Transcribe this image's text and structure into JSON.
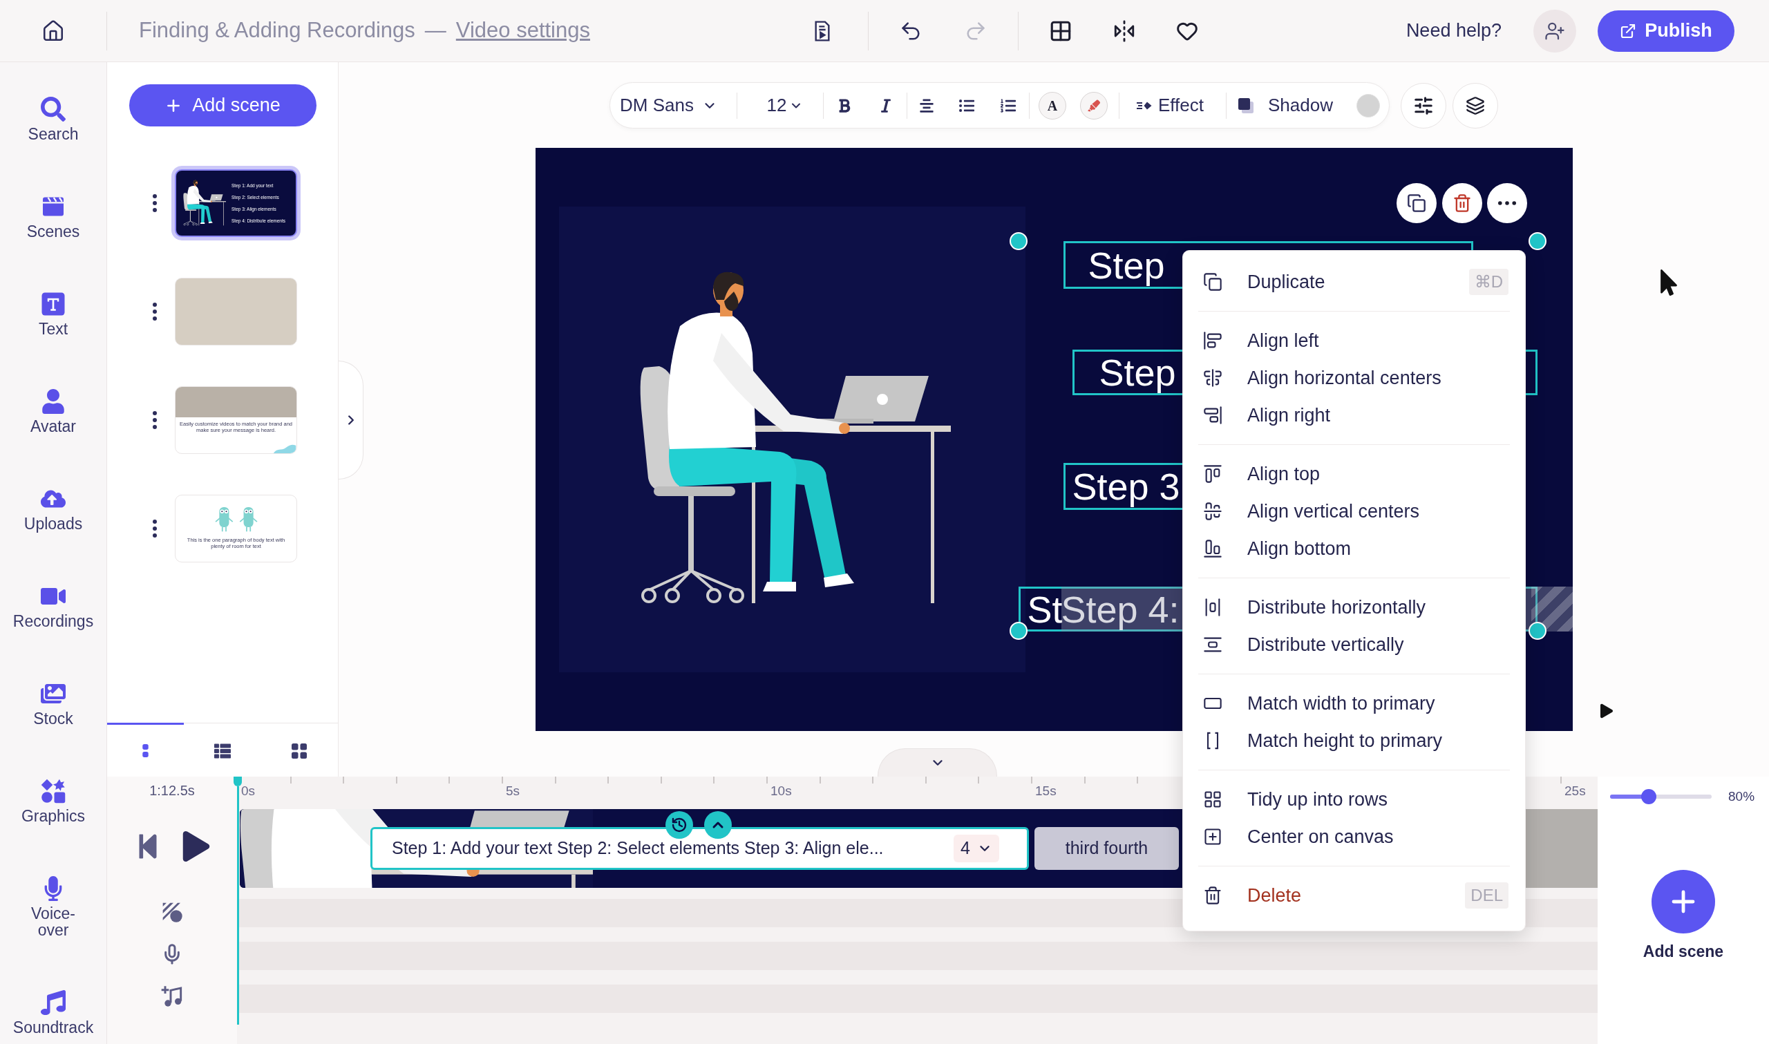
{
  "header": {
    "title": "Finding & Adding Recordings",
    "separator": "—",
    "settings_link": "Video settings",
    "help": "Need help?",
    "publish": "Publish"
  },
  "rail": [
    {
      "label": "Search"
    },
    {
      "label": "Scenes"
    },
    {
      "label": "Text"
    },
    {
      "label": "Avatar"
    },
    {
      "label": "Uploads"
    },
    {
      "label": "Recordings"
    },
    {
      "label": "Stock"
    },
    {
      "label": "Graphics"
    },
    {
      "label": "Voice-over"
    },
    {
      "label": "Soundtrack"
    }
  ],
  "scenes_panel": {
    "add_button": "Add scene",
    "scenes": [
      {
        "kind": "steps",
        "selected": true,
        "texts": [
          "Step 1: Add your text",
          "Step 2: Select elements",
          "Step 3: Align elements",
          "Step 4: Distribute elements"
        ]
      },
      {
        "kind": "photo",
        "selected": false
      },
      {
        "kind": "photo_caption",
        "selected": false,
        "caption": "Easily customize videos to match your brand and make sure your message is heard."
      },
      {
        "kind": "characters",
        "selected": false,
        "caption": "This is the one paragraph of body text with plenty of room for text"
      }
    ],
    "view_tabs": [
      {
        "selected": true
      },
      {
        "selected": false
      },
      {
        "selected": false
      }
    ]
  },
  "toolbar": {
    "font": "DM Sans",
    "size": "12",
    "color_glyph": "A",
    "effect": "Effect",
    "shadow": "Shadow"
  },
  "canvas": {
    "frames": [
      {
        "text": "Step"
      },
      {
        "text": "Step"
      },
      {
        "text": "Step 3"
      },
      {
        "text": "St"
      }
    ],
    "drag_preview": {
      "text": "Step 4:"
    }
  },
  "context_menu": {
    "groups": [
      [
        {
          "label": "Duplicate",
          "shortcut": "⌘D",
          "kind": "normal"
        }
      ],
      [
        {
          "label": "Align left",
          "kind": "normal"
        },
        {
          "label": "Align horizontal centers",
          "kind": "normal"
        },
        {
          "label": "Align right",
          "kind": "normal"
        }
      ],
      [
        {
          "label": "Align top",
          "kind": "normal"
        },
        {
          "label": "Align vertical centers",
          "kind": "normal"
        },
        {
          "label": "Align bottom",
          "kind": "normal"
        }
      ],
      [
        {
          "label": "Distribute horizontally",
          "kind": "normal"
        },
        {
          "label": "Distribute vertically",
          "kind": "normal"
        }
      ],
      [
        {
          "label": "Match width to primary",
          "kind": "normal"
        },
        {
          "label": "Match height to primary",
          "kind": "normal"
        }
      ],
      [
        {
          "label": "Tidy up into rows",
          "kind": "normal"
        },
        {
          "label": "Center on canvas",
          "kind": "normal"
        }
      ],
      [
        {
          "label": "Delete",
          "shortcut": "DEL",
          "kind": "danger"
        }
      ]
    ]
  },
  "timeline": {
    "duration": "1:12.5s",
    "ruler_labels": [
      "0s",
      "5s",
      "10s",
      "15s"
    ],
    "ruler_end_label": "25s",
    "text_clip": {
      "text": "Step 1: Add your text Step 2: Select elements Step 3: Align ele...",
      "count": "4"
    },
    "next_clip": "third fourth",
    "zoom": {
      "level": 0.38,
      "reading": "80%"
    },
    "add_scene": "Add scene"
  }
}
